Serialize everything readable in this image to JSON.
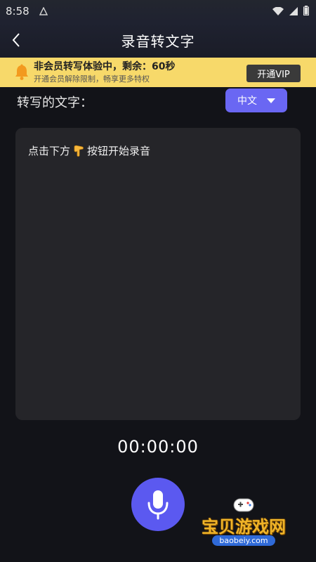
{
  "status_bar": {
    "time": "8:58"
  },
  "header": {
    "title": "录音转文字"
  },
  "banner": {
    "title": "非会员转写体验中，剩余：60秒",
    "subtitle": "开通会员解除限制，畅享更多特权",
    "vip_button": "开通VIP",
    "background_color": "#f7d96a"
  },
  "transcript": {
    "label": "转写的文字：",
    "language": "中文",
    "prompt_before": "点击下方",
    "prompt_after": "按钮开始录音"
  },
  "recorder": {
    "timer": "00:00:00",
    "accent_color": "#5b59f0"
  },
  "watermark": {
    "name": "宝贝游戏网",
    "url": "baobeiy.com"
  },
  "icons": {
    "back": "chevron-left-icon",
    "bell": "bell-icon",
    "dropdown": "caret-down-icon",
    "pointer": "pointing-down-hand-icon",
    "mic": "microphone-icon"
  }
}
